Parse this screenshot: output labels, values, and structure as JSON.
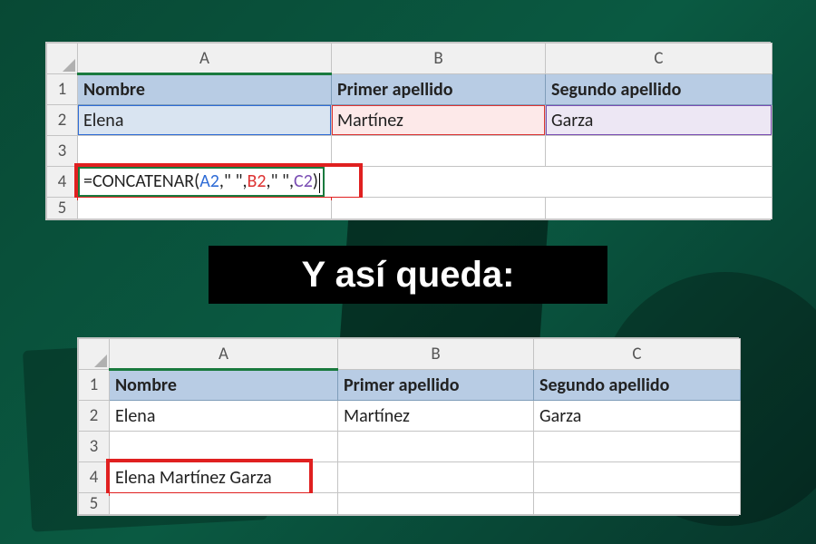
{
  "caption": "Y así queda:",
  "columns": {
    "a": "A",
    "b": "B",
    "c": "C"
  },
  "rows": {
    "r1": "1",
    "r2": "2",
    "r3": "3",
    "r4": "4",
    "r5": "5"
  },
  "headers": {
    "nombre": "Nombre",
    "primer": "Primer apellido",
    "segundo": "Segundo apellido"
  },
  "data_row": {
    "nombre": "Elena",
    "primer": "Martínez",
    "segundo": "Garza"
  },
  "formula": {
    "prefix": "=CONCATENAR(",
    "ref_a": "A2",
    "sep1": ",\" \",",
    "ref_b": "B2",
    "sep2": ",\" \",",
    "ref_c": "C2",
    "suffix": ")"
  },
  "result": "Elena Martínez Garza"
}
